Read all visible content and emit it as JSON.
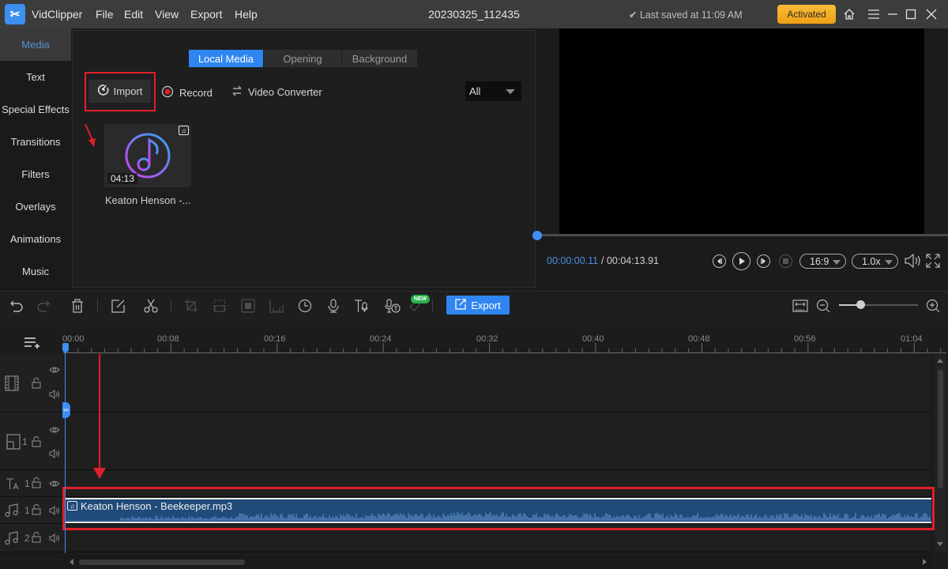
{
  "titlebar": {
    "app_name": "VidClipper",
    "menus": [
      "File",
      "Edit",
      "View",
      "Export",
      "Help"
    ],
    "project_title": "20230325_112435",
    "saved_status": "✔ Last saved at 11:09 AM",
    "activated_label": "Activated"
  },
  "left_nav": {
    "items": [
      {
        "label": "Media",
        "active": true
      },
      {
        "label": "Text"
      },
      {
        "label": "Special Effects"
      },
      {
        "label": "Transitions"
      },
      {
        "label": "Filters"
      },
      {
        "label": "Overlays"
      },
      {
        "label": "Animations"
      },
      {
        "label": "Music"
      }
    ]
  },
  "media_panel": {
    "tabs": [
      {
        "label": "Local Media",
        "active": true
      },
      {
        "label": "Opening"
      },
      {
        "label": "Background"
      }
    ],
    "tools": {
      "import_label": "Import",
      "record_label": "Record",
      "converter_label": "Video Converter"
    },
    "filter": {
      "selected": "All"
    },
    "items": [
      {
        "name": "Keaton Henson -...",
        "duration": "04:13",
        "type_icon": "music-note-icon"
      }
    ]
  },
  "preview": {
    "current_time": "00:00:00.11",
    "total_time": "/ 00:04:13.91",
    "aspect_ratio": "16:9",
    "speed": "1.0x",
    "seek_progress": 0.0004
  },
  "timeline_toolbar": {
    "export_label": "Export",
    "new_badge": "NEW",
    "zoom_level": 0.28
  },
  "timeline": {
    "ruler_ticks": [
      "00:00",
      "00:08",
      "00:16",
      "00:24",
      "00:32",
      "00:40",
      "00:48",
      "00:56",
      "01:04"
    ],
    "tracks": [
      {
        "type": "video",
        "label": ""
      },
      {
        "type": "pip",
        "label": "1"
      },
      {
        "type": "text",
        "label": "1"
      },
      {
        "type": "music",
        "label": "1"
      },
      {
        "type": "music",
        "label": "2"
      }
    ],
    "audio_clip": {
      "name": "Keaton Henson - Beekeeper.mp3"
    }
  },
  "colors": {
    "accent": "#2f86f0",
    "activated": "#f2a91f",
    "highlight": "#e0202a",
    "clip": "#1f4a7a",
    "new_badge": "#27b24a"
  }
}
